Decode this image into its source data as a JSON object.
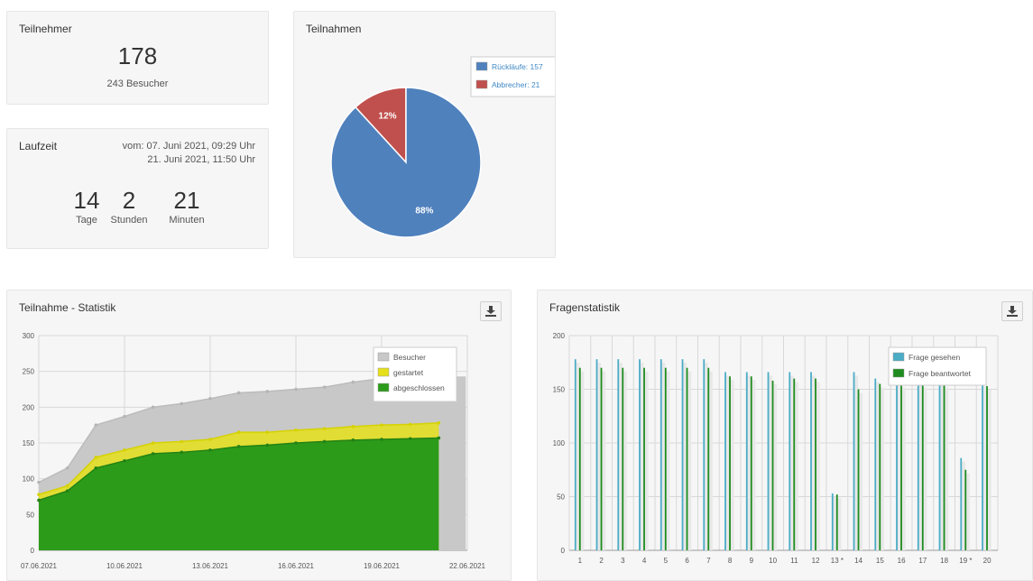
{
  "teilnehmer": {
    "title": "Teilnehmer",
    "count": "178",
    "visitors": "243 Besucher"
  },
  "laufzeit": {
    "title": "Laufzeit",
    "from": "vom: 07. Juni 2021, 09:29 Uhr",
    "to": "21. Juni 2021, 11:50 Uhr",
    "days": "14",
    "days_label": "Tage",
    "hours": "2",
    "hours_label": "Stunden",
    "minutes": "21",
    "minutes_label": "Minuten"
  },
  "teilnahmen": {
    "title": "Teilnahmen",
    "legend": [
      "Rückläufe: 157",
      "Abbrecher: 21"
    ],
    "colors": {
      "rueckläufe": "#4f81bd",
      "abbrecher": "#c0504d"
    }
  },
  "statistik": {
    "title": "Teilnahme - Statistik",
    "download_icon": "download-icon"
  },
  "fragen": {
    "title": "Fragenstatistik",
    "download_icon": "download-icon"
  },
  "chart_data": [
    {
      "type": "pie",
      "title": "Teilnahmen",
      "labels": [
        "Rückläufe: 157",
        "Abbrecher: 21"
      ],
      "values": [
        157,
        21
      ],
      "slice_labels": [
        "88%",
        "12%"
      ],
      "colors": [
        "#4f81bd",
        "#c0504d"
      ],
      "legend": "top-right"
    },
    {
      "type": "area",
      "title": "Teilnahme - Statistik",
      "x": [
        "07.06.2021",
        "08.06.2021",
        "09.06.2021",
        "10.06.2021",
        "11.06.2021",
        "12.06.2021",
        "13.06.2021",
        "14.06.2021",
        "15.06.2021",
        "16.06.2021",
        "17.06.2021",
        "18.06.2021",
        "19.06.2021",
        "20.06.2021",
        "21.06.2021"
      ],
      "xticks": [
        "07.06.2021",
        "10.06.2021",
        "13.06.2021",
        "16.06.2021",
        "19.06.2021",
        "22.06.2021"
      ],
      "ylim": [
        0,
        300
      ],
      "yticks": [
        "0",
        "50",
        "100",
        "150",
        "200",
        "250",
        "300"
      ],
      "grid": true,
      "legend": "top-right",
      "series": [
        {
          "name": "Besucher",
          "color": "#c8c8c8",
          "values": [
            95,
            115,
            175,
            187,
            200,
            205,
            212,
            220,
            222,
            225,
            228,
            235,
            240,
            242,
            243
          ]
        },
        {
          "name": "gestartet",
          "color": "#e5e01a",
          "values": [
            78,
            90,
            130,
            140,
            150,
            152,
            155,
            165,
            165,
            168,
            170,
            173,
            175,
            176,
            178
          ]
        },
        {
          "name": "abgeschlossen",
          "color": "#2d9b1a",
          "values": [
            70,
            83,
            115,
            125,
            135,
            137,
            140,
            145,
            147,
            150,
            152,
            154,
            155,
            156,
            157
          ]
        }
      ]
    },
    {
      "type": "bar",
      "title": "Fragenstatistik",
      "categories": [
        "1",
        "2",
        "3",
        "4",
        "5",
        "6",
        "7",
        "8",
        "9",
        "10",
        "11",
        "12",
        "13 *",
        "14",
        "15",
        "16",
        "17",
        "18",
        "19 *",
        "20"
      ],
      "ylim": [
        0,
        200
      ],
      "yticks": [
        "0",
        "50",
        "100",
        "150",
        "200"
      ],
      "grid": true,
      "legend": "top-right",
      "series": [
        {
          "name": "Frage gesehen",
          "color": "#4bacc6",
          "values": [
            178,
            178,
            178,
            178,
            178,
            178,
            178,
            166,
            166,
            166,
            166,
            166,
            53,
            166,
            160,
            160,
            160,
            160,
            86,
            156
          ]
        },
        {
          "name": "Frage beantwortet",
          "color": "#1e8c1e",
          "values": [
            170,
            170,
            170,
            170,
            170,
            170,
            170,
            162,
            162,
            158,
            160,
            160,
            52,
            150,
            155,
            155,
            155,
            155,
            75,
            153
          ]
        }
      ]
    }
  ]
}
